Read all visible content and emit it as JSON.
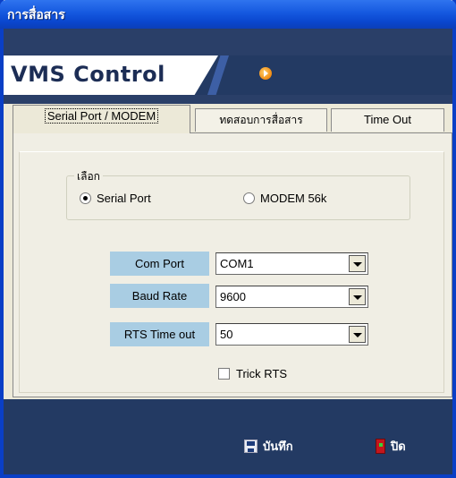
{
  "window": {
    "title": "การสื่อสาร"
  },
  "banner": {
    "logo_text": "VMS Control",
    "play_icon": "play-circle-icon"
  },
  "tabs": [
    {
      "label": "Serial Port / MODEM",
      "active": true
    },
    {
      "label": "ทดสอบการสื่อสาร",
      "active": false
    },
    {
      "label": "Time Out",
      "active": false
    }
  ],
  "select_group": {
    "legend": "เลือก",
    "options": [
      {
        "label": "Serial Port",
        "selected": true
      },
      {
        "label": "MODEM 56k",
        "selected": false
      }
    ]
  },
  "fields": {
    "com_port": {
      "label": "Com Port",
      "value": "COM1"
    },
    "baud_rate": {
      "label": "Baud Rate",
      "value": "9600"
    },
    "rts_timeout": {
      "label": "RTS Time out",
      "value": "50"
    }
  },
  "trick_rts": {
    "label": "Trick RTS",
    "checked": false
  },
  "footer": {
    "save_label": "บันทึก",
    "close_label": "ปิด"
  },
  "colors": {
    "titlebar": "#0a47cf",
    "banner": "#233a63",
    "field_label_bg": "#a9cde3",
    "accent_orange": "#f08a12"
  }
}
